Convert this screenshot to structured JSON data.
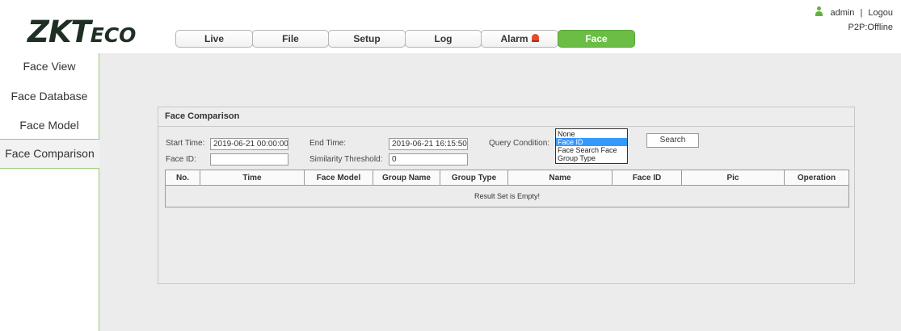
{
  "brand": {
    "logo_main": "ZKT",
    "logo_tail": "ECO"
  },
  "nav": {
    "tabs": [
      {
        "label": "Live"
      },
      {
        "label": "File"
      },
      {
        "label": "Setup"
      },
      {
        "label": "Log"
      },
      {
        "label": "Alarm"
      },
      {
        "label": "Face",
        "active": true
      }
    ]
  },
  "user": {
    "name": "admin",
    "separator": "|",
    "logout": "Logou",
    "p2p_status": "P2P:Offline"
  },
  "sidebar": {
    "items": [
      {
        "label": "Face View"
      },
      {
        "label": "Face Database"
      },
      {
        "label": "Face Model"
      },
      {
        "label": "Face Comparison",
        "active": true
      }
    ]
  },
  "panel": {
    "title": "Face Comparison",
    "start_time_label": "Start Time:",
    "start_time_value": "2019-06-21 00:00:00",
    "end_time_label": "End Time:",
    "end_time_value": "2019-06-21 16:15:50",
    "query_label": "Query Condition:",
    "query_options": [
      "None",
      "Face ID",
      "Face Search Face",
      "Group Type"
    ],
    "query_selected": "Face ID",
    "face_id_label": "Face ID:",
    "face_id_value": "",
    "threshold_label": "Similarity Threshold:",
    "threshold_value": "0",
    "search_button": "Search"
  },
  "table": {
    "columns": [
      "No.",
      "Time",
      "Face Model",
      "Group Name",
      "Group Type",
      "Name",
      "Face ID",
      "Pic",
      "Operation"
    ],
    "empty_message": "Result Set is Empty!"
  },
  "colors": {
    "accent_green": "#6cbd45",
    "selection_blue": "#3399ff",
    "alarm_red": "#e34a2f"
  },
  "icons": {
    "user": "user-icon",
    "alarm": "alarm-bell-icon"
  }
}
